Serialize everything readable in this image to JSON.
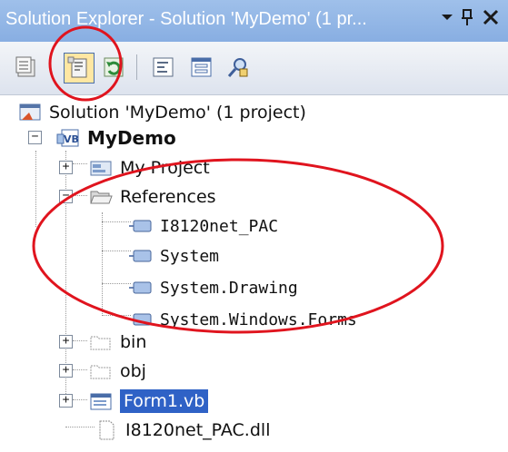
{
  "window": {
    "title": "Solution Explorer - Solution 'MyDemo' (1 pr...",
    "dropdown_icon": "chevron-down-icon",
    "pin_icon": "pin-icon",
    "close_icon": "close-icon"
  },
  "toolbar": {
    "buttons": [
      {
        "name": "properties",
        "icon": "properties-icon"
      },
      {
        "name": "show-all-files",
        "icon": "show-all-files-icon",
        "highlighted": true
      },
      {
        "name": "refresh",
        "icon": "refresh-icon"
      },
      {
        "name": "view-code",
        "icon": "view-code-icon"
      },
      {
        "name": "view-designer",
        "icon": "view-designer-icon"
      },
      {
        "name": "class-view",
        "icon": "class-view-icon"
      }
    ]
  },
  "tree": {
    "solution": "Solution 'MyDemo' (1 project)",
    "project": "MyDemo",
    "my_project": "My Project",
    "references": "References",
    "reference_items": [
      "I8120net_PAC",
      "System",
      "System.Drawing",
      "System.Windows.Forms"
    ],
    "bin": "bin",
    "obj": "obj",
    "form": "Form1.vb",
    "dll": "I8120net_PAC.dll"
  },
  "annotations": {
    "circle_color": "#e0141e"
  },
  "colors": {
    "titlebar": "#93b6e6",
    "selection": "#2f62c6"
  }
}
